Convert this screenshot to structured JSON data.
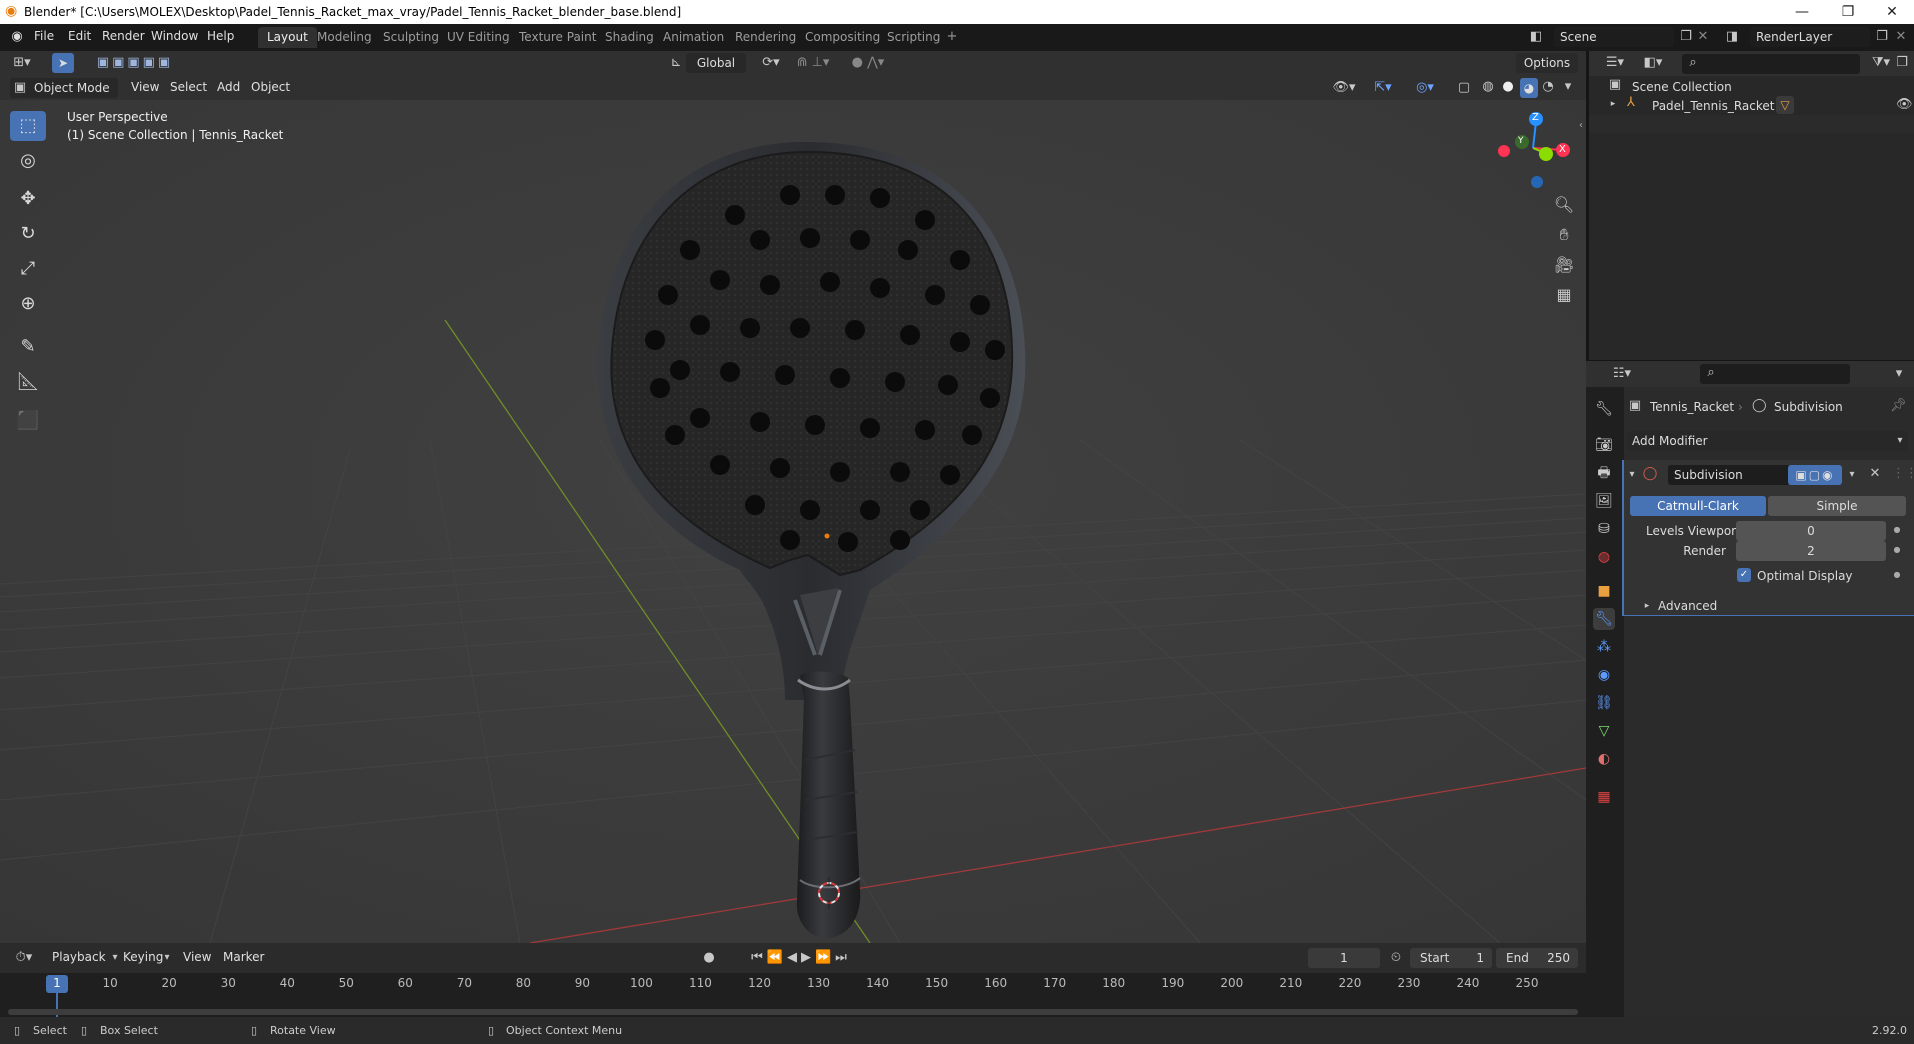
{
  "window": {
    "title": "Blender* [C:\\Users\\MOLEX\\Desktop\\Padel_Tennis_Racket_max_vray/Padel_Tennis_Racket_blender_base.blend]",
    "controls": [
      "—",
      "❐",
      "✕"
    ]
  },
  "menu": [
    "File",
    "Edit",
    "Render",
    "Window",
    "Help"
  ],
  "workspaces": [
    "Layout",
    "Modeling",
    "Sculpting",
    "UV Editing",
    "Texture Paint",
    "Shading",
    "Animation",
    "Rendering",
    "Compositing",
    "Scripting"
  ],
  "active_workspace": "Layout",
  "scene": {
    "label": "Scene",
    "render_layer": "RenderLayer"
  },
  "viewport_header": {
    "transform_orientation": "Global",
    "options_label": "Options",
    "mode": "Object Mode",
    "menus": [
      "View",
      "Select",
      "Add",
      "Object"
    ]
  },
  "viewport": {
    "perspective": "User Perspective",
    "collection_info": "(1) Scene Collection | Tennis_Racket",
    "gizmo_axes": {
      "z": "Z",
      "y": "Y",
      "x": "X"
    }
  },
  "tools": [
    "select-box",
    "cursor",
    "move",
    "rotate",
    "scale",
    "transform",
    "annotate",
    "measure",
    "add-cube"
  ],
  "outliner": {
    "root": "Scene Collection",
    "items": [
      {
        "label": "Padel_Tennis_Racket"
      }
    ]
  },
  "properties": {
    "breadcrumb_object": "Tennis_Racket",
    "breadcrumb_modifier": "Subdivision",
    "add_modifier": "Add Modifier",
    "modifier": {
      "name": "Subdivision",
      "type_options": [
        "Catmull-Clark",
        "Simple"
      ],
      "selected_type": "Catmull-Clark",
      "levels_viewport_label": "Levels Viewport",
      "levels_viewport": "0",
      "render_label": "Render",
      "render": "2",
      "optimal_display_label": "Optimal Display",
      "optimal_display": true,
      "advanced_label": "Advanced"
    }
  },
  "timeline": {
    "menus": [
      "Playback",
      "Keying",
      "View",
      "Marker"
    ],
    "current_frame": "1",
    "start_label": "Start",
    "start": "1",
    "end_label": "End",
    "end": "250",
    "ticks": [
      "1",
      "10",
      "20",
      "30",
      "40",
      "50",
      "60",
      "70",
      "80",
      "90",
      "100",
      "110",
      "120",
      "130",
      "140",
      "150",
      "160",
      "170",
      "180",
      "190",
      "200",
      "210",
      "220",
      "230",
      "240",
      "250"
    ]
  },
  "statusbar": {
    "select": "Select",
    "box_select": "Box Select",
    "rotate_view": "Rotate View",
    "context_menu": "Object Context Menu",
    "version": "2.92.0"
  },
  "colors": {
    "accent": "#4772b3",
    "x_axis": "#ff3352",
    "y_axis": "#8bdc00",
    "z_axis": "#2890ff",
    "origin": "#e87d0d"
  }
}
